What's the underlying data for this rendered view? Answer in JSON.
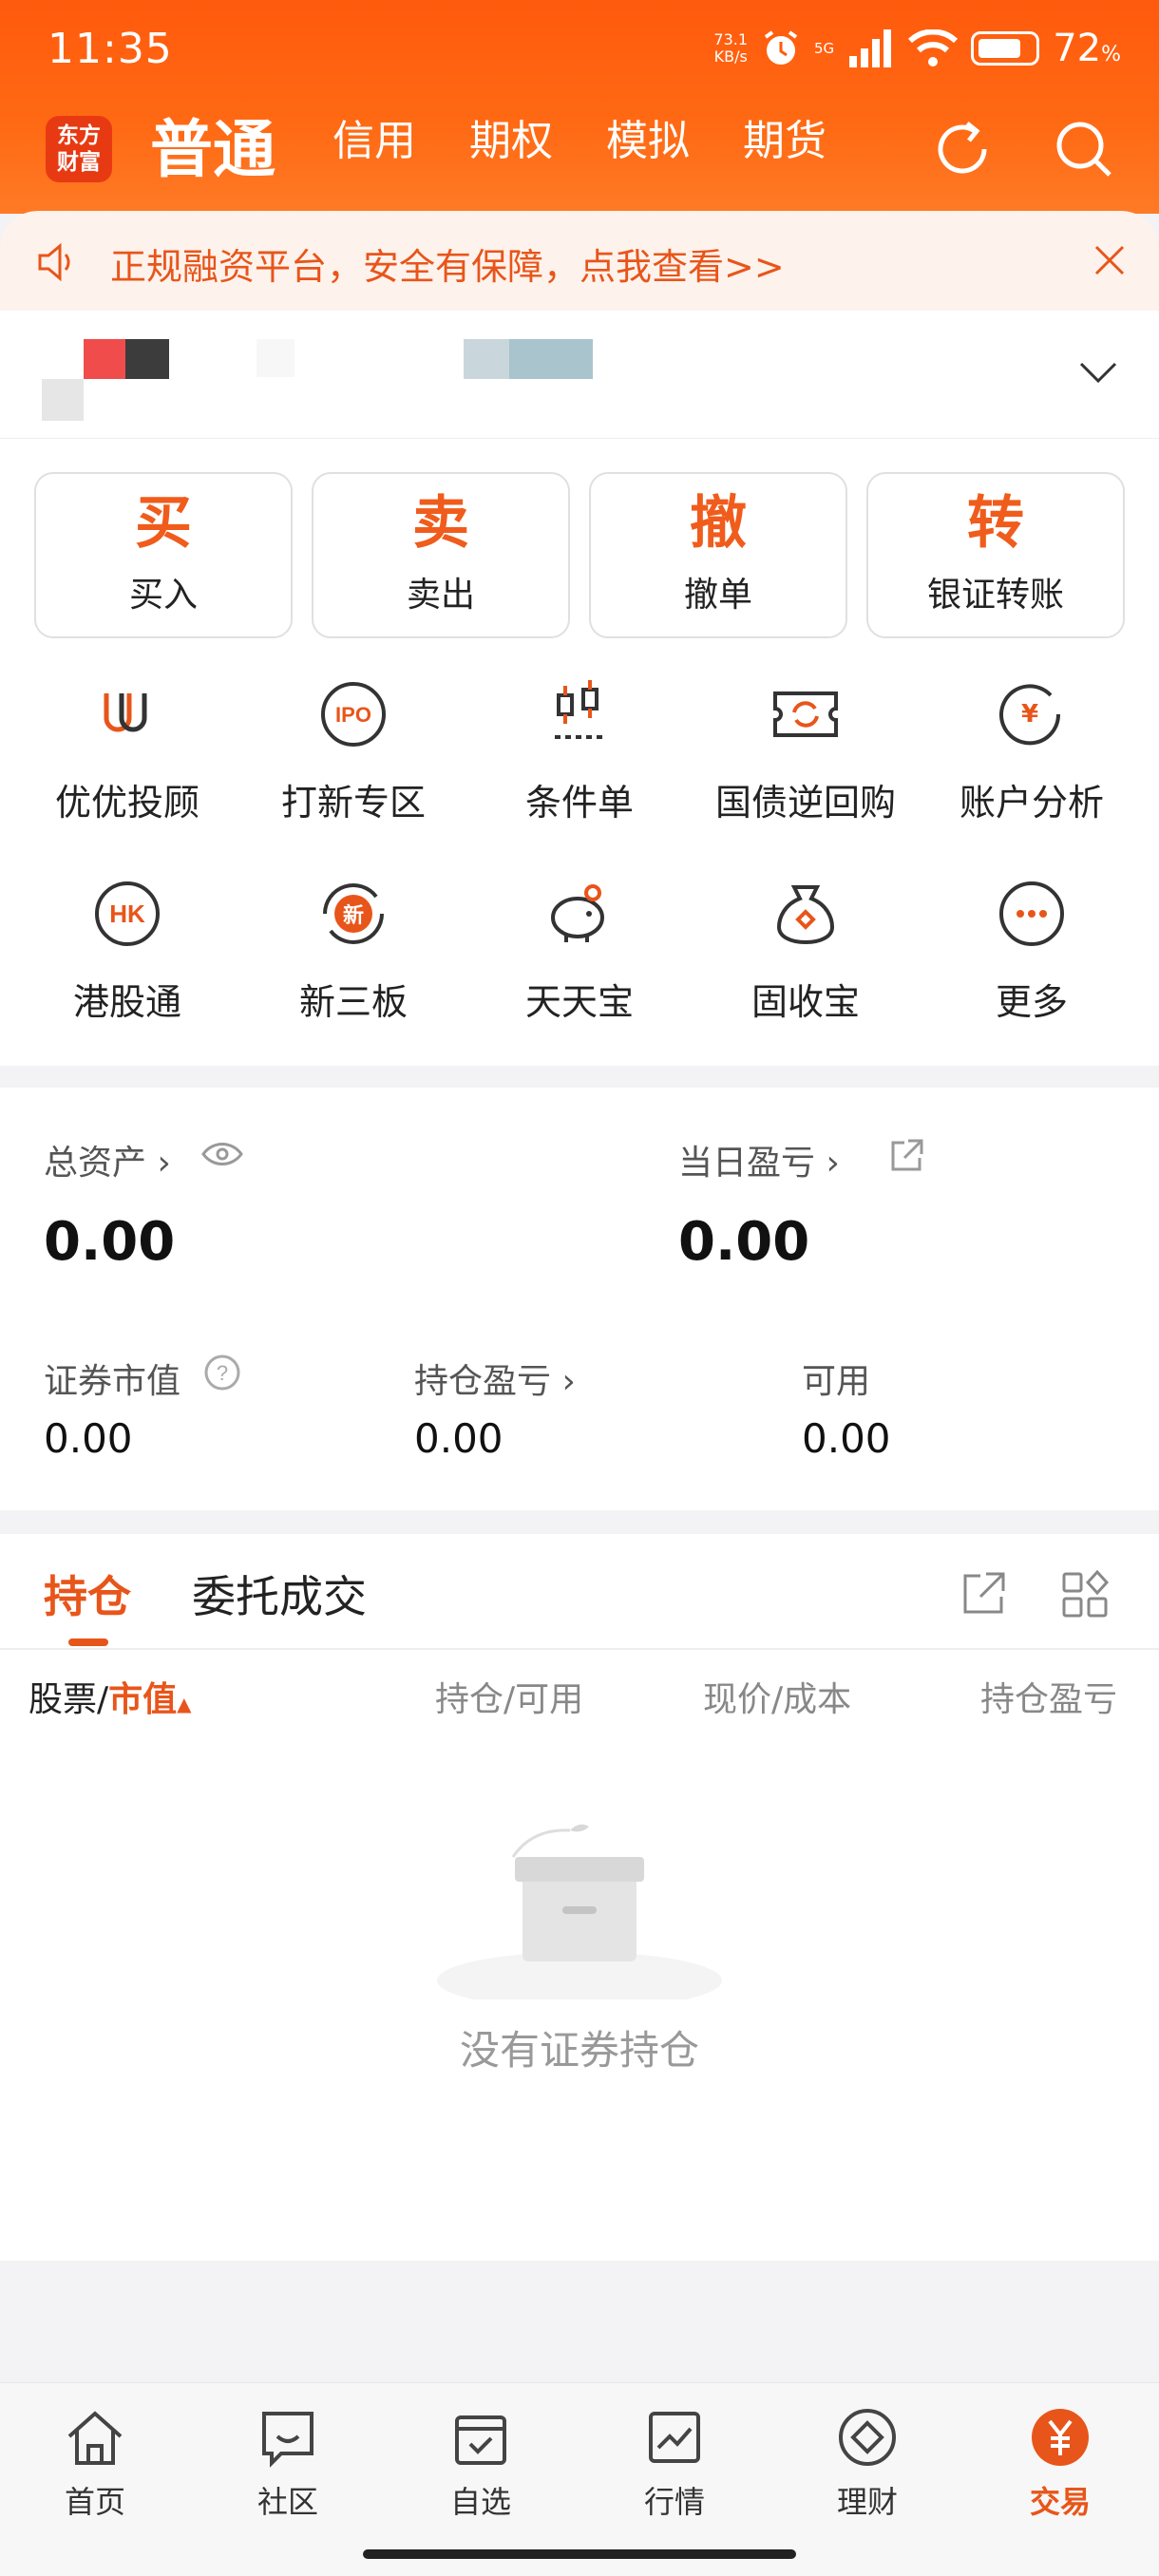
{
  "status_bar": {
    "time": "11:35",
    "speed_value": "73.1",
    "speed_unit": "KB/s",
    "network": "5G",
    "signal_sub": "6",
    "battery": "72",
    "battery_unit": "%"
  },
  "nav": {
    "logo_line1": "东方",
    "logo_line2": "财富",
    "tabs": [
      "普通",
      "信用",
      "期权",
      "模拟",
      "期货"
    ]
  },
  "notice": {
    "text": "正规融资平台，安全有保障，点我查看>>"
  },
  "actions": [
    {
      "glyph": "买",
      "label": "买入"
    },
    {
      "glyph": "卖",
      "label": "卖出"
    },
    {
      "glyph": "撤",
      "label": "撤单"
    },
    {
      "glyph": "转",
      "label": "银证转账"
    }
  ],
  "services_row1": [
    {
      "label": "优优投顾",
      "icon": "uu-advisor-icon"
    },
    {
      "label": "打新专区",
      "icon": "ipo-icon"
    },
    {
      "label": "条件单",
      "icon": "conditional-order-icon"
    },
    {
      "label": "国债逆回购",
      "icon": "repo-icon"
    },
    {
      "label": "账户分析",
      "icon": "account-analysis-icon"
    }
  ],
  "services_row2": [
    {
      "label": "港股通",
      "icon": "hk-icon"
    },
    {
      "label": "新三板",
      "icon": "new-board-icon"
    },
    {
      "label": "天天宝",
      "icon": "piggy-bank-icon"
    },
    {
      "label": "固收宝",
      "icon": "money-bag-icon"
    },
    {
      "label": "更多",
      "icon": "more-icon"
    }
  ],
  "assets": {
    "total_label": "总资产",
    "total_value": "0.00",
    "daily_pl_label": "当日盈亏",
    "daily_pl_value": "0.00",
    "market_value_label": "证券市值",
    "market_value": "0.00",
    "position_pl_label": "持仓盈亏",
    "position_pl": "0.00",
    "available_label": "可用",
    "available": "0.00"
  },
  "positions": {
    "tabs": [
      "持仓",
      "委托成交"
    ],
    "col_stock": "股票/",
    "col_market_value": "市值",
    "col_qty": "持仓/可用",
    "col_price": "现价/成本",
    "col_pl": "持仓盈亏",
    "empty_text": "没有证券持仓"
  },
  "bottom_nav": [
    {
      "label": "首页"
    },
    {
      "label": "社区"
    },
    {
      "label": "自选"
    },
    {
      "label": "行情"
    },
    {
      "label": "理财"
    },
    {
      "label": "交易"
    }
  ],
  "colors": {
    "brand": "#ff5a0d",
    "accent": "#e8551a"
  }
}
